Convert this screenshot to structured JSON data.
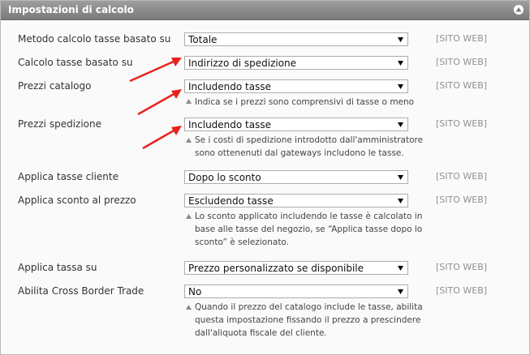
{
  "panel": {
    "title": "Impostazioni di calcolo"
  },
  "rows": [
    {
      "label": "Metodo calcolo tasse basato su",
      "value": "Totale",
      "scope": "[SITO WEB]"
    },
    {
      "label": "Calcolo tasse basato su",
      "value": "Indirizzo di spedizione",
      "scope": "[SITO WEB]"
    },
    {
      "label": "Prezzi catalogo",
      "value": "Includendo tasse",
      "scope": "[SITO WEB]",
      "hint": "Indica se i prezzi sono comprensivi di tasse o meno"
    },
    {
      "label": "Prezzi spedizione",
      "value": "Includendo tasse",
      "scope": "[SITO WEB]",
      "hint": "Se i costi di spedizione introdotto dall'amministratore sono ottenenuti dal gateways includono le tasse."
    },
    {
      "label": "Applica tasse cliente",
      "value": "Dopo lo sconto",
      "scope": "[SITO WEB]"
    },
    {
      "label": "Applica sconto al prezzo",
      "value": "Escludendo tasse",
      "scope": "[SITO WEB]",
      "hint": "Lo sconto applicato includendo le tasse è calcolato in base alle tasse del negozio, se “Applica tasse dopo lo sconto” è selezionato."
    },
    {
      "label": "Applica tassa su",
      "value": "Prezzo personalizzato se disponibile",
      "scope": "[SITO WEB]"
    },
    {
      "label": "Abilita Cross Border Trade",
      "value": "No",
      "scope": "[SITO WEB]",
      "hint": "Quando il prezzo del catalogo include le tasse, abilita questa impostazione fissando il prezzo a prescindere dall'aliquota fiscale del cliente."
    }
  ],
  "colors": {
    "annotation_arrow": "#e8231e",
    "header_bg": "#8c8c8c",
    "scope_text": "#909090"
  },
  "icons": {
    "collapse": "chevron-up-icon",
    "dropdown": "dropdown-caret-icon",
    "hint": "hint-pointer-icon"
  }
}
